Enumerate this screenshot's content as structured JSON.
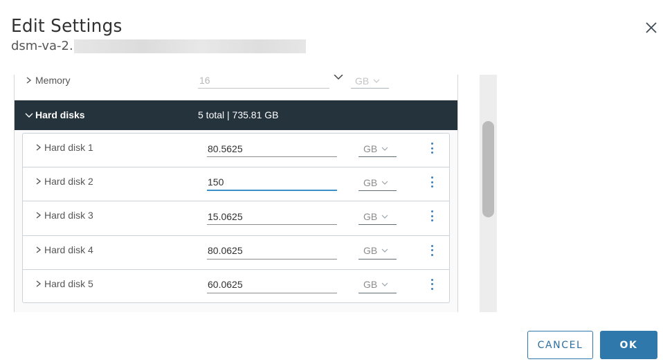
{
  "dialog": {
    "title": "Edit Settings",
    "subtitle": "dsm-va-2.",
    "close_icon": "close-icon"
  },
  "memory": {
    "label": "Memory",
    "value": "16",
    "unit": "GB"
  },
  "hard_disks": {
    "label": "Hard disks",
    "summary": "5 total | 735.81 GB",
    "disks": [
      {
        "label": "Hard disk 1",
        "value": "80.5625",
        "unit": "GB",
        "focused": false
      },
      {
        "label": "Hard disk 2",
        "value": "150",
        "unit": "GB",
        "focused": true
      },
      {
        "label": "Hard disk 3",
        "value": "15.0625",
        "unit": "GB",
        "focused": false
      },
      {
        "label": "Hard disk 4",
        "value": "80.0625",
        "unit": "GB",
        "focused": false
      },
      {
        "label": "Hard disk 5",
        "value": "60.0625",
        "unit": "GB",
        "focused": false
      }
    ]
  },
  "footer": {
    "cancel_label": "CANCEL",
    "ok_label": "OK"
  },
  "colors": {
    "header_bg": "#25333d",
    "primary": "#2f78ac",
    "focus_underline": "#3a8fc9"
  }
}
